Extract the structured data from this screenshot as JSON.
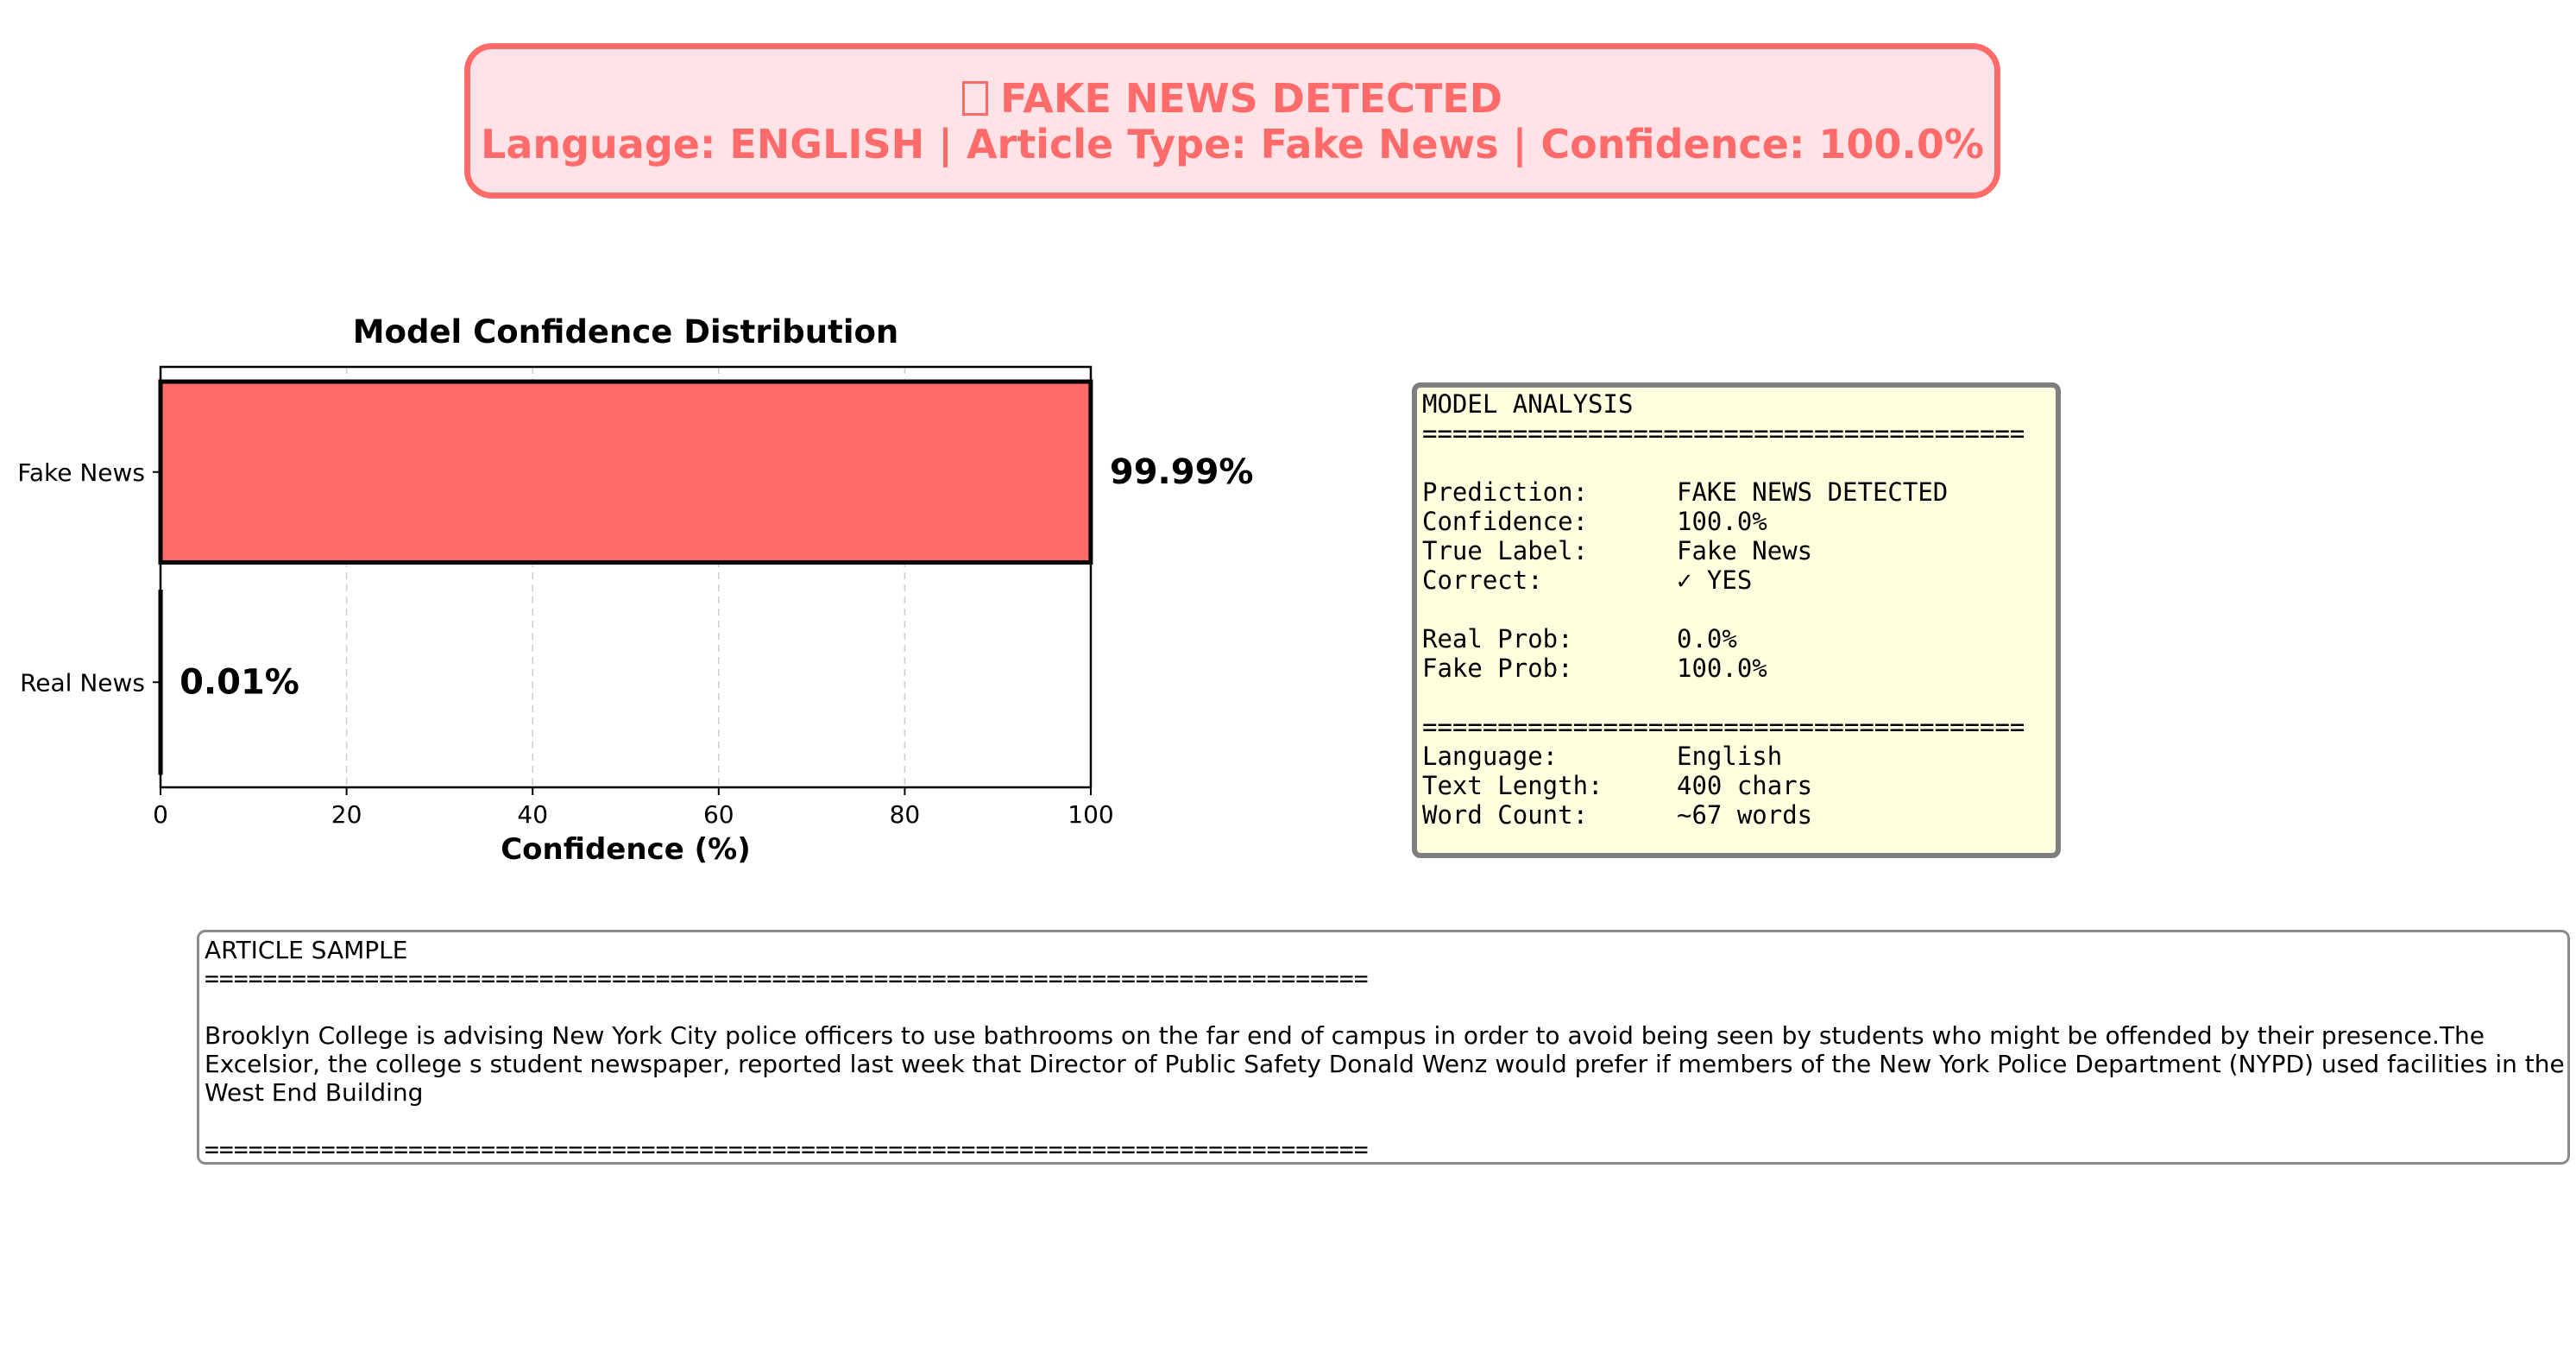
{
  "banner": {
    "line1": "FAKE NEWS DETECTED",
    "line2": "Language: ENGLISH | Article Type: Fake News | Confidence: 100.0%",
    "color": "#ff6b6b",
    "background": "#ffe3e6"
  },
  "chart_data": {
    "type": "bar",
    "orientation": "horizontal",
    "title": "Model Confidence Distribution",
    "xlabel": "Confidence (%)",
    "ylabel": "",
    "categories": [
      "Fake News",
      "Real News"
    ],
    "values": [
      99.99,
      0.01
    ],
    "value_labels": [
      "99.99%",
      "0.01%"
    ],
    "colors": [
      "#ff6b6b",
      "#4ecdc4"
    ],
    "xlim": [
      0,
      100
    ],
    "xticks": [
      "0",
      "20",
      "40",
      "60",
      "80",
      "100"
    ],
    "grid": "x-dashed"
  },
  "analysis": {
    "title": "MODEL ANALYSIS",
    "separator": "========================================",
    "prediction_key": "Prediction:",
    "prediction_val": "FAKE NEWS DETECTED",
    "confidence_key": "Confidence:",
    "confidence_val": "100.0%",
    "true_label_key": "True Label:",
    "true_label_val": "Fake News",
    "correct_key": "Correct:",
    "correct_val": "✓ YES",
    "real_prob_key": "Real Prob:",
    "real_prob_val": "0.0%",
    "fake_prob_key": "Fake Prob:",
    "fake_prob_val": "100.0%",
    "language_key": "Language:",
    "language_val": "English",
    "text_length_key": "Text Length:",
    "text_length_val": "400 chars",
    "word_count_key": "Word Count:",
    "word_count_val": "~67 words"
  },
  "article": {
    "title": "ARTICLE SAMPLE",
    "separator": "================================================================================",
    "text": "Brooklyn College is advising New York City police officers to use bathrooms on the far end of campus in order to avoid being seen by students who might be offended by their presence.The Excelsior, the college s student newspaper, reported last week that Director of Public Safety Donald Wenz would  prefer  if members of the New York Police Department (NYPD) used facilities in the West End Building"
  }
}
